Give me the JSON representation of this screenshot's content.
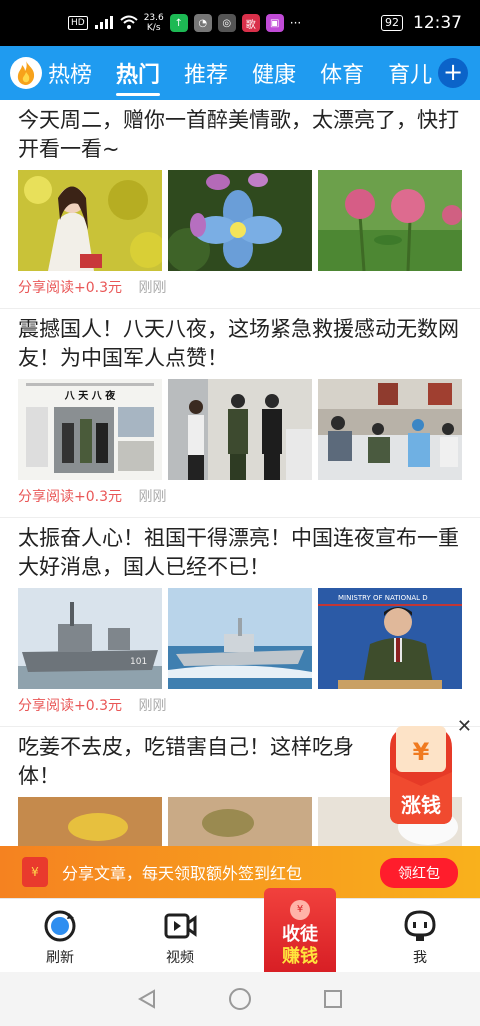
{
  "status_bar": {
    "left_badge": "HD",
    "network_speed": "23.6\nK/s",
    "app_icon_label": "歌",
    "more": "···",
    "battery": "92",
    "time": "12:37"
  },
  "top_nav": {
    "tabs": [
      {
        "label": "热榜"
      },
      {
        "label": "热门",
        "active": true
      },
      {
        "label": "推荐"
      },
      {
        "label": "健康"
      },
      {
        "label": "体育"
      },
      {
        "label": "育儿"
      }
    ],
    "plus_label": "+"
  },
  "articles": [
    {
      "title": "今天周二，赠你一首醉美情歌，太漂亮了，快打开看一看~",
      "share": "分享阅读+0.3元",
      "time": "刚刚"
    },
    {
      "title": "震撼国人！八天八夜，这场紧急救援感动无数网友！为中国军人点赞！",
      "share": "分享阅读+0.3元",
      "time": "刚刚",
      "newspaper_headline": "八  天  八  夜"
    },
    {
      "title": "太振奋人心！祖国干得漂亮！中国连夜宣布一重大好消息，国人已经不已！",
      "share": "分享阅读+0.3元",
      "time": "刚刚",
      "ship_number": "101",
      "backdrop_text": "MINISTRY OF NATIONAL D"
    },
    {
      "title": "吃姜不去皮，吃错害自己！这样吃身体！"
    }
  ],
  "float_reward": {
    "coin_symbol": "¥",
    "label": "涨钱",
    "close": "✕"
  },
  "banner": {
    "envelope_symbol": "¥",
    "text": "分享文章，每天领取额外签到红包",
    "button": "领红包"
  },
  "bottom_nav": {
    "items": [
      {
        "label": "刷新",
        "icon": "refresh-icon"
      },
      {
        "label": "视频",
        "icon": "video-icon"
      },
      {
        "label": "我",
        "icon": "profile-icon"
      }
    ],
    "center": {
      "coin": "¥",
      "line1": "收徒",
      "line2": "赚钱"
    }
  },
  "colors": {
    "nav_blue": "#1f9bf0",
    "share_red": "#e95757",
    "banner_orange": "#f58220"
  }
}
